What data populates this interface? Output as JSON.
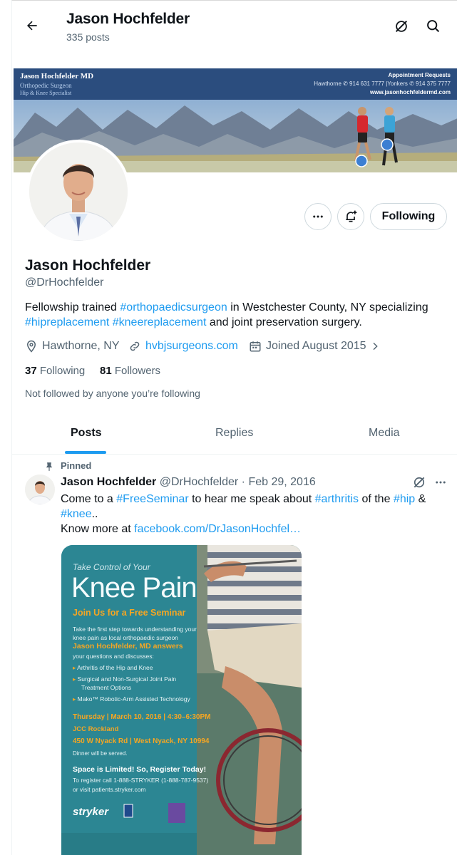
{
  "header": {
    "title": "Jason Hochfelder",
    "post_count": "335 posts"
  },
  "banner": {
    "line1": "Jason Hochfelder MD",
    "line2": "Orthopedic Surgeon",
    "line3": "Hip & Knee Specialist",
    "right1": "Appointment Requests",
    "right2": "Hawthorne ✆ 914 631 7777  |Yonkers ✆ 914 375 7777",
    "right3": "www.jasonhochfeldermd.com"
  },
  "profile": {
    "name": "Jason Hochfelder",
    "handle": "@DrHochfelder",
    "bio_1": "Fellowship trained ",
    "bio_tag1": "#orthopaedicsurgeon",
    "bio_2": " in Westchester County, NY specializing ",
    "bio_tag2": "#hipreplacement",
    "bio_3": " ",
    "bio_tag3": "#kneereplacement",
    "bio_4": " and joint preservation surgery.",
    "location": "Hawthorne, NY",
    "website": "hvbjsurgeons.com",
    "joined": "Joined August 2015",
    "following_count": "37",
    "following_label": "Following",
    "followers_count": "81",
    "followers_label": "Followers",
    "not_followed": "Not followed by anyone you’re following",
    "following_button": "Following"
  },
  "tabs": [
    "Posts",
    "Replies",
    "Media"
  ],
  "pinned_tweet": {
    "pinned_label": "Pinned",
    "author": "Jason Hochfelder",
    "handle_date": "@DrHochfelder · Feb 29, 2016",
    "t1": "Come to a ",
    "tag1": "#FreeSeminar",
    "t2": " to hear me speak about ",
    "tag2": "#arthritis",
    "t3": " of the ",
    "tag3": "#hip",
    "t4": " &",
    "tag4": "#knee",
    "t5": "..",
    "t6": "Know more at ",
    "link": "facebook.com/DrJasonHochfel…"
  },
  "flyer": {
    "kicker": "Take Control of Your",
    "title": "Knee Pain",
    "subtitle": "Join Us for a Free Seminar",
    "intro1": "Take the first step towards understanding your",
    "intro2": "knee pain as local orthopaedic surgeon",
    "speaker": "Jason Hochfelder, MD answers",
    "intro3": "your questions and discusses:",
    "b1": "Arthritis of the Hip and Knee",
    "b2a": "Surgical and Non-Surgical Joint Pain",
    "b2b": "Treatment Options",
    "b3": "Mako™ Robotic-Arm Assisted Technology",
    "when": "Thursday | March 10, 2016 | 4:30–6:30PM",
    "venue": "JCC Rockland",
    "address": "450 W Nyack Rd | West Nyack, NY 10994",
    "dinner": "Dinner will be served.",
    "space": "Space is Limited! So, Register Today!",
    "register1": "To register call 1-888-STRYKER (1-888-787-9537)",
    "register2": "or visit patients.stryker.com",
    "brand": "stryker"
  },
  "colors": {
    "accent": "#1d9bf0",
    "text": "#0f1419",
    "muted": "#536471",
    "flyer_teal": "#2c8693",
    "flyer_orange": "#f5a623"
  }
}
